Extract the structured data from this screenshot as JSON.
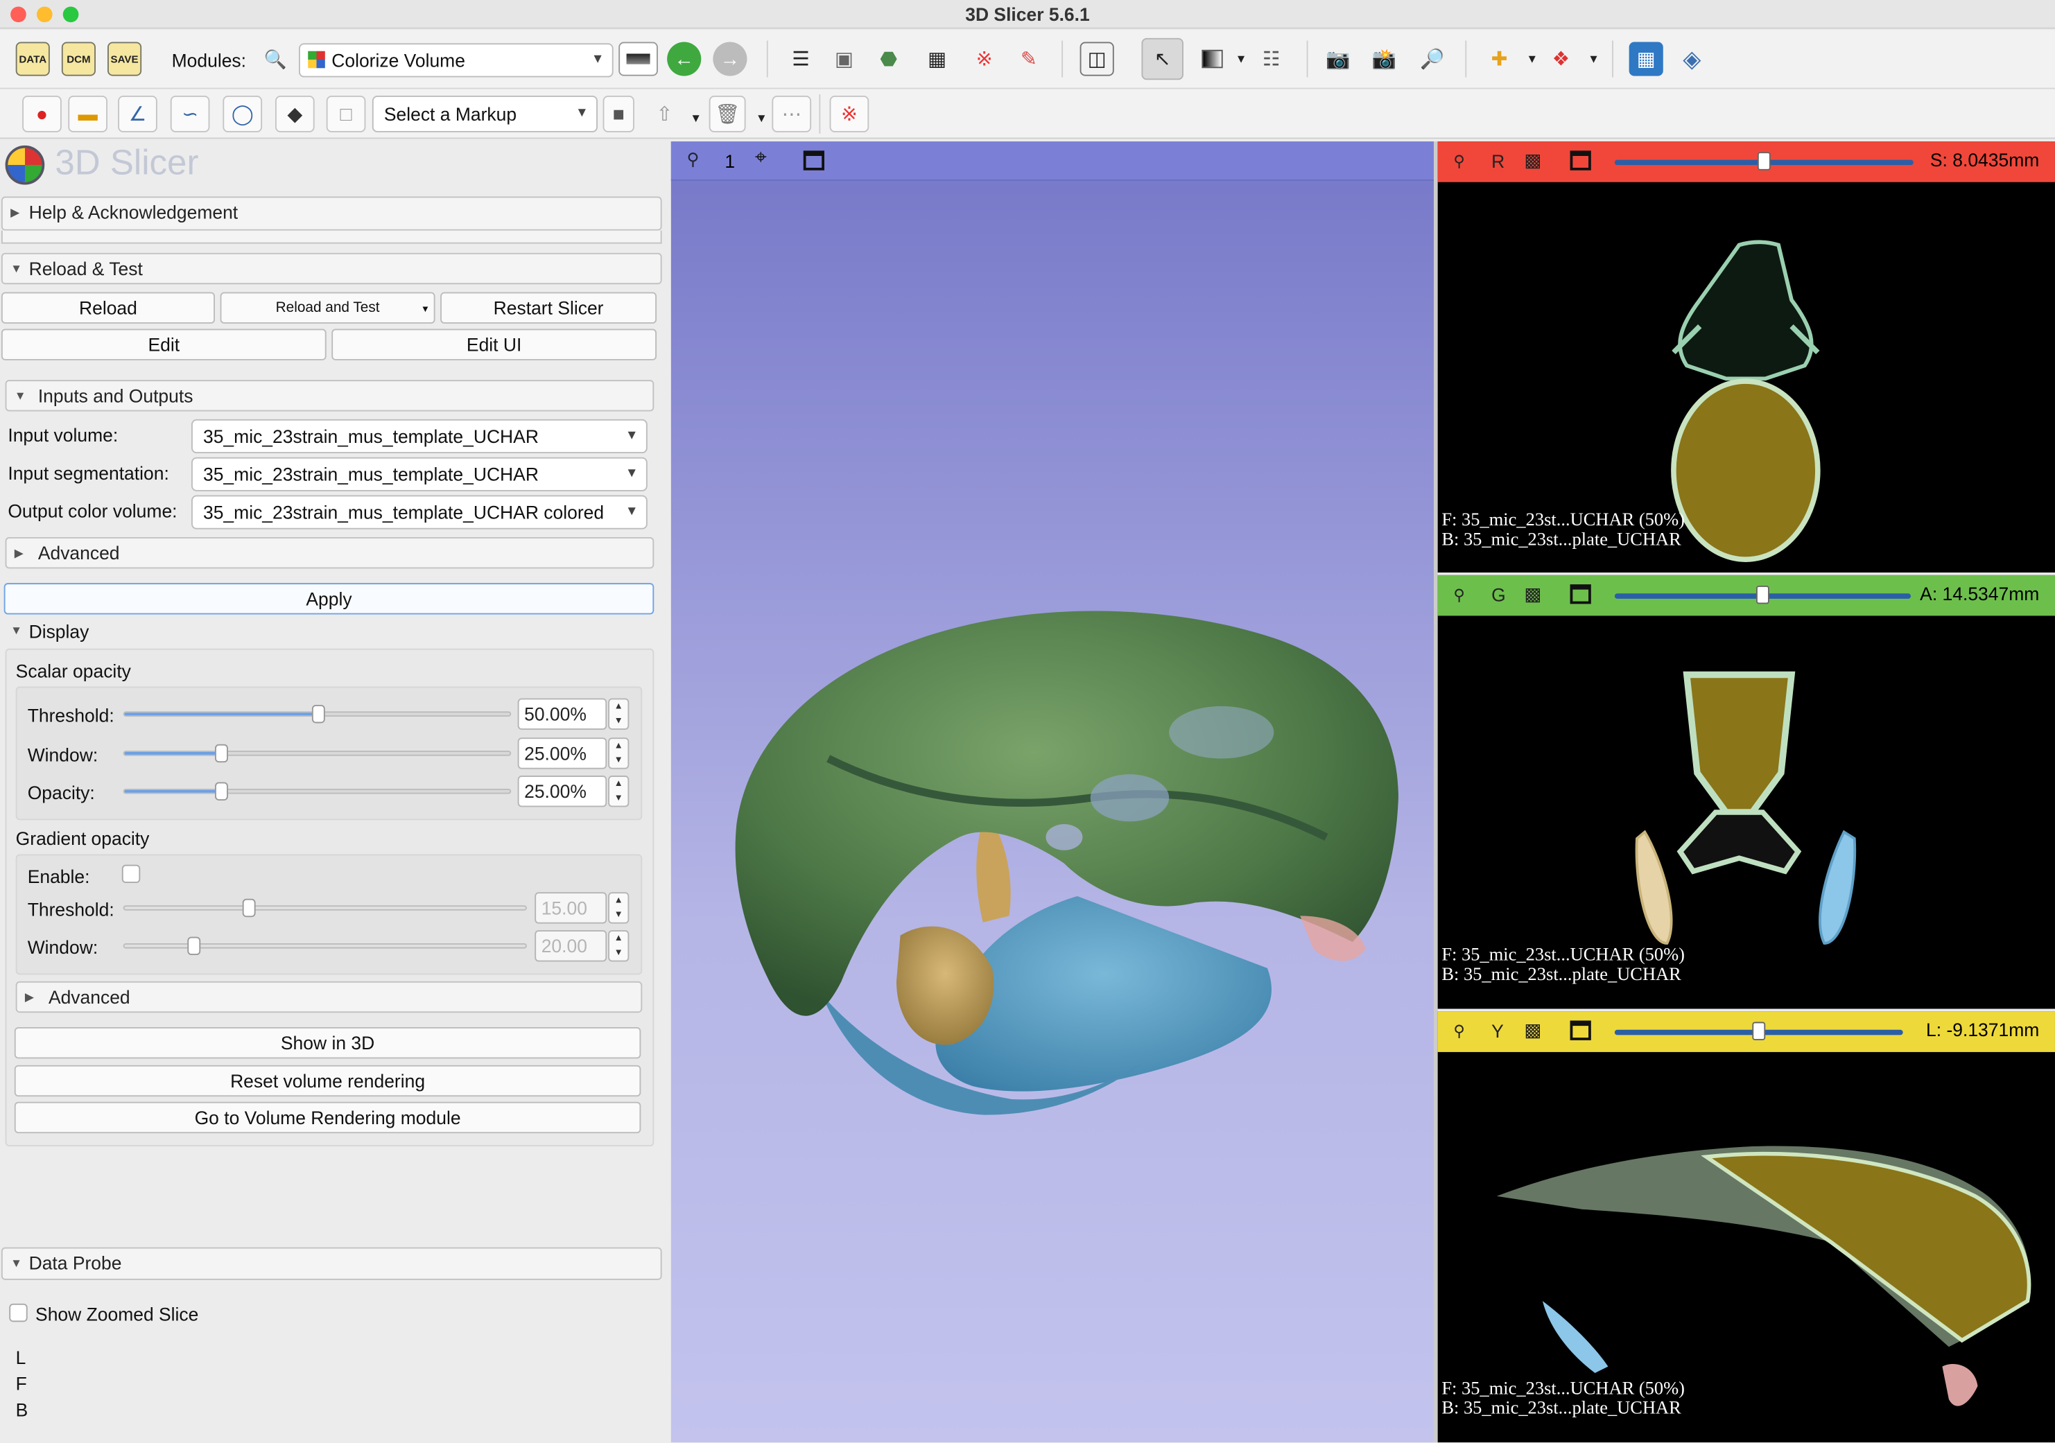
{
  "window": {
    "title": "3D Slicer 5.6.1"
  },
  "toolbar": {
    "data_label": "DATA",
    "dcm_label": "DCM",
    "save_label": "SAVE",
    "modules_label": "Modules:",
    "module_selected": "Colorize Volume",
    "markup_selected": "Select a Markup"
  },
  "panel": {
    "logo_text": "3D Slicer",
    "help_section": "Help & Acknowledgement",
    "reload_section": "Reload & Test",
    "reload_btn": "Reload",
    "reload_test_btn": "Reload and Test",
    "restart_btn": "Restart Slicer",
    "edit_btn": "Edit",
    "edit_ui_btn": "Edit UI",
    "io_section": "Inputs and Outputs",
    "input_volume_label": "Input volume:",
    "input_volume_value": "35_mic_23strain_mus_template_UCHAR",
    "input_seg_label": "Input segmentation:",
    "input_seg_value": "35_mic_23strain_mus_template_UCHAR",
    "output_label": "Output color volume:",
    "output_value": "35_mic_23strain_mus_template_UCHAR colored",
    "advanced_label": "Advanced",
    "apply_btn": "Apply",
    "display_label": "Display",
    "scalar_opacity_label": "Scalar opacity",
    "threshold_label": "Threshold:",
    "threshold_value": "50.00%",
    "threshold_level": 0.5,
    "window_label": "Window:",
    "window_value": "25.00%",
    "window_level": 0.25,
    "opacity_label": "Opacity:",
    "opacity_value": "25.00%",
    "opacity_level": 0.25,
    "gradient_opacity_label": "Gradient opacity",
    "enable_label": "Enable:",
    "g_threshold_label": "Threshold:",
    "g_threshold_value": "15.00",
    "g_window_label": "Window:",
    "g_window_value": "20.00",
    "advanced2_label": "Advanced",
    "show3d_btn": "Show in 3D",
    "reset_vr_btn": "Reset volume rendering",
    "goto_vr_btn": "Go to Volume Rendering module",
    "data_probe_label": "Data Probe",
    "show_zoomed_label": "Show Zoomed Slice",
    "probe_l": "L",
    "probe_f": "F",
    "probe_b": "B"
  },
  "view3d": {
    "layout_number": "1"
  },
  "slices": {
    "red": {
      "letter": "R",
      "offset": "S: 8.0435mm",
      "fg": "F: 35_mic_23st...UCHAR (50%)",
      "bg": "B: 35_mic_23st...plate_UCHAR",
      "color": "#f0473a"
    },
    "green": {
      "letter": "G",
      "offset": "A: 14.5347mm",
      "fg": "F: 35_mic_23st...UCHAR (50%)",
      "bg": "B: 35_mic_23st...plate_UCHAR",
      "color": "#6dbf4c"
    },
    "yellow": {
      "letter": "Y",
      "offset": "L: -9.1371mm",
      "fg": "F: 35_mic_23st...UCHAR (50%)",
      "bg": "B: 35_mic_23st...plate_UCHAR",
      "color": "#eed93a"
    }
  }
}
